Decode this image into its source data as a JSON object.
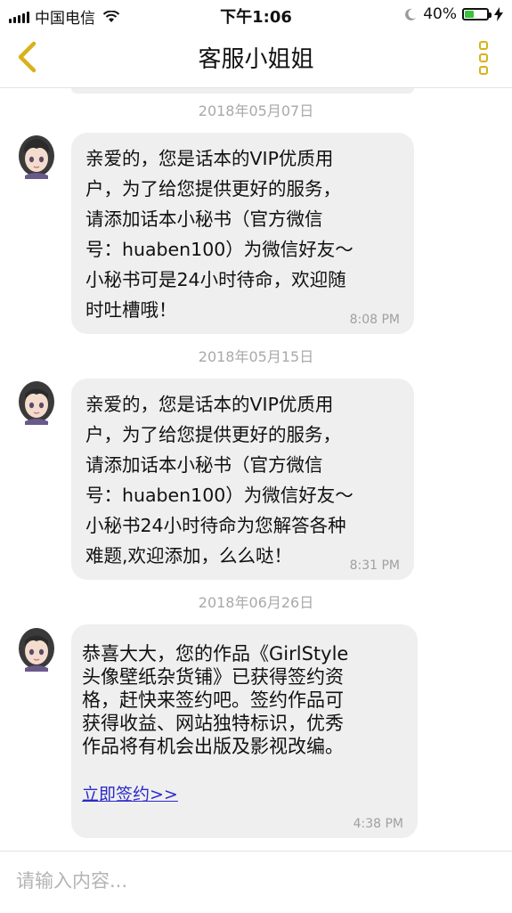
{
  "status_bar": {
    "carrier": "中国电信",
    "time": "下午1:06",
    "battery": "40%",
    "battery_level": 0.4
  },
  "nav": {
    "title": "客服小姐姐"
  },
  "messages": [
    {
      "date": "2018年05月07日",
      "text": "亲爱的，您是话本的VIP优质用\n户，为了给您提供更好的服务，\n请添加话本小秘书（官方微信\n号：huaben100）为微信好友～\n小秘书可是24小时待命，欢迎随\n时吐槽哦！",
      "time": "8:08 PM"
    },
    {
      "date": "2018年05月15日",
      "text": "亲爱的，您是话本的VIP优质用\n户，为了给您提供更好的服务，\n请添加话本小秘书（官方微信\n号：huaben100）为微信好友～\n小秘书24小时待命为您解答各种\n难题,欢迎添加，么么哒！",
      "time": "8:31 PM"
    },
    {
      "date": "2018年06月26日",
      "text": " 恭喜大大，您的作品《GirlStyle\n头像壁纸杂货铺》已获得签约资\n格，赶快来签约吧。签约作品可\n获得收益、网站独特标识，优秀\n作品将有机会出版及影视改编。",
      "link": "立即签约>>",
      "time": "4:38 PM"
    }
  ],
  "input": {
    "placeholder": "请输入内容..."
  },
  "colors": {
    "accent": "#d9b11b",
    "bubble": "#efefef",
    "link": "#2a2ac8"
  }
}
